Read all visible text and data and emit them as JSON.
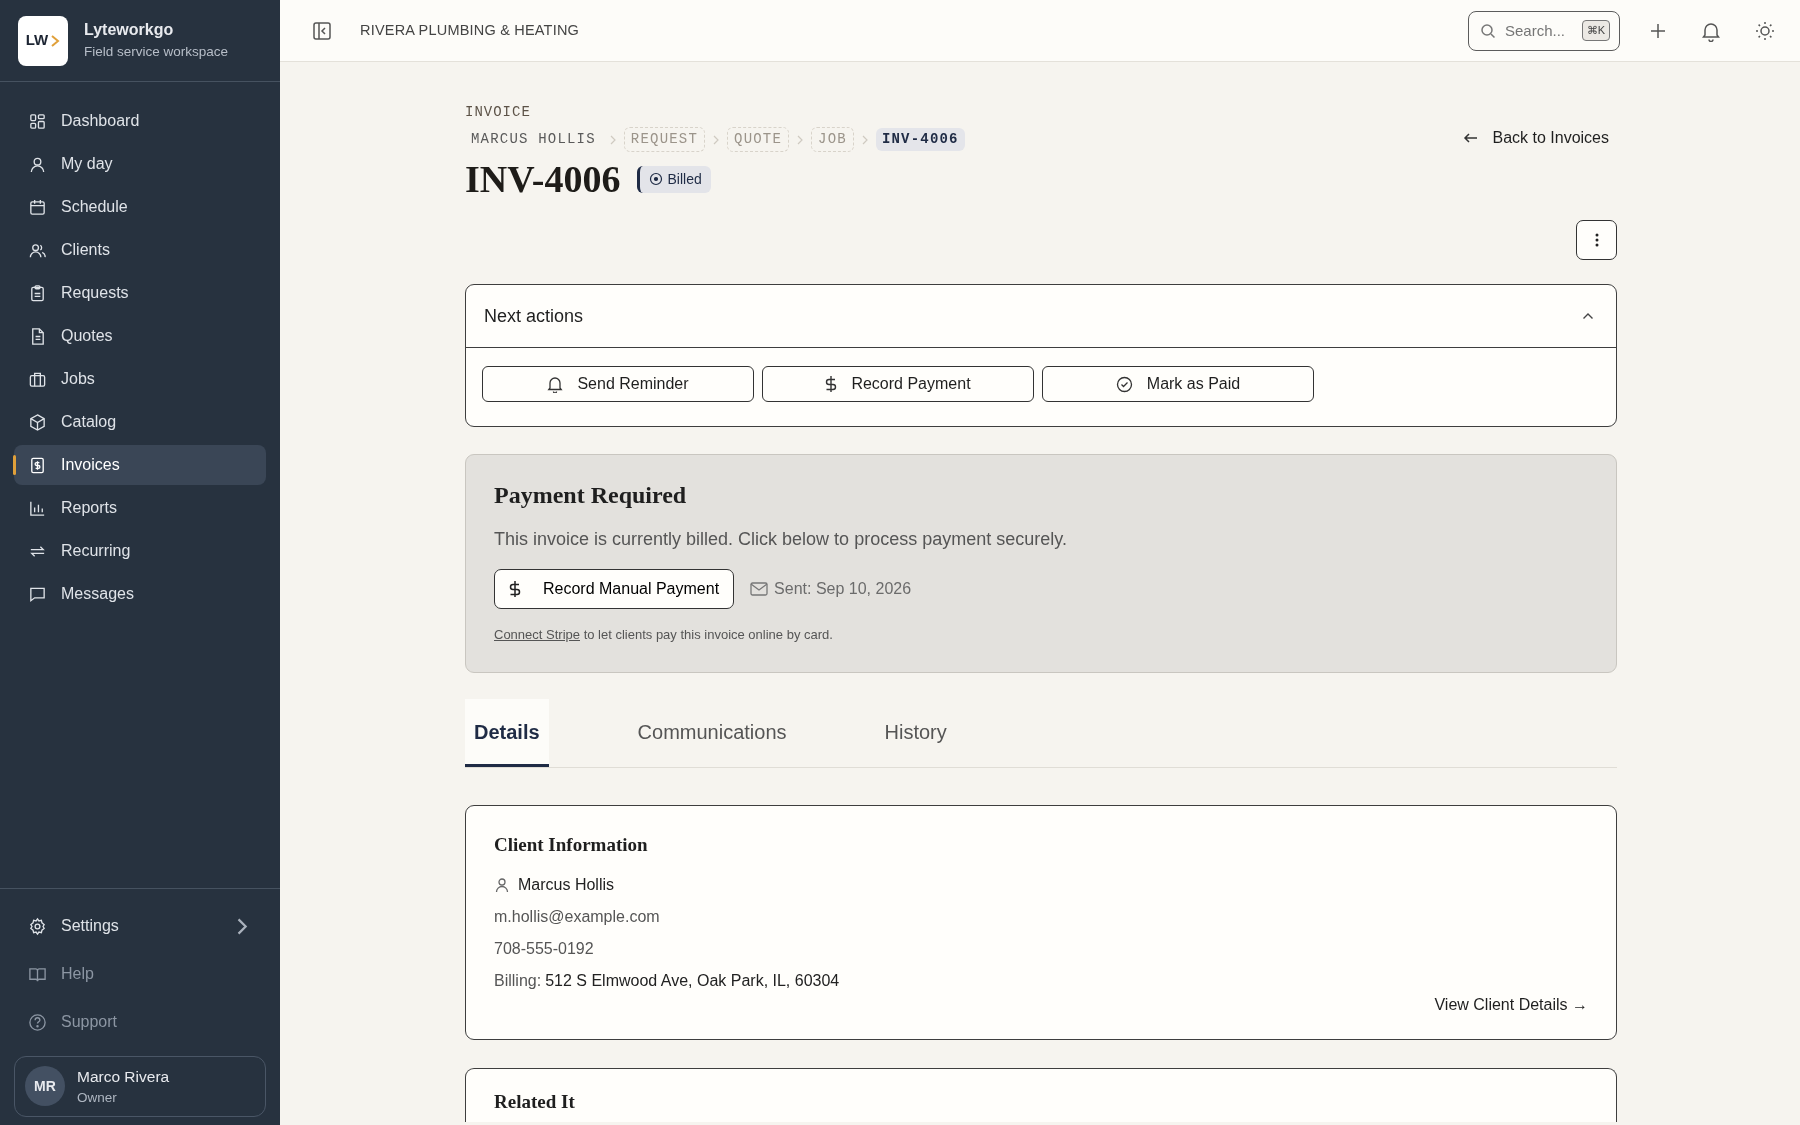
{
  "sidebar": {
    "brand": {
      "logo_text": "LW",
      "name": "Lyteworkgo",
      "subtitle": "Field service workspace"
    },
    "items": [
      {
        "label": "Dashboard",
        "selected": false
      },
      {
        "label": "My day",
        "selected": false
      },
      {
        "label": "Schedule",
        "selected": false
      },
      {
        "label": "Clients",
        "selected": false
      },
      {
        "label": "Requests",
        "selected": false
      },
      {
        "label": "Quotes",
        "selected": false
      },
      {
        "label": "Jobs",
        "selected": false
      },
      {
        "label": "Catalog",
        "selected": false
      },
      {
        "label": "Invoices",
        "selected": true
      },
      {
        "label": "Reports",
        "selected": false
      },
      {
        "label": "Recurring",
        "selected": false
      },
      {
        "label": "Messages",
        "selected": false
      }
    ],
    "footer_items": [
      {
        "label": "Settings",
        "disabled": false,
        "has_submenu": true
      },
      {
        "label": "Help",
        "disabled": true,
        "has_submenu": false
      },
      {
        "label": "Support",
        "disabled": true,
        "has_submenu": false
      }
    ],
    "user": {
      "initials": "MR",
      "name": "Marco Rivera",
      "role": "Owner"
    }
  },
  "topbar": {
    "company": "RIVERA PLUMBING & HEATING",
    "search": {
      "placeholder": "Search...",
      "shortcut": "⌘K"
    }
  },
  "header": {
    "eyebrow": "INVOICE",
    "breadcrumbs": [
      {
        "label": "MARCUS HOLLIS",
        "kind": "plain"
      },
      {
        "label": "REQUEST",
        "kind": "dashed"
      },
      {
        "label": "QUOTE",
        "kind": "dashed"
      },
      {
        "label": "JOB",
        "kind": "dashed"
      },
      {
        "label": "INV-4006",
        "kind": "current"
      }
    ],
    "title": "INV-4006",
    "status": "Billed",
    "back_link": "Back to Invoices"
  },
  "next_actions": {
    "title": "Next actions",
    "expanded": true,
    "buttons": [
      "Send Reminder",
      "Record Payment",
      "Mark as Paid"
    ]
  },
  "payment": {
    "title": "Payment Required",
    "message": "This invoice is currently billed. Click below to process payment securely.",
    "button": "Record Manual Payment",
    "sent": "Sent: Sep 10, 2026",
    "stripe_link": "Connect Stripe",
    "stripe_note": "to let clients pay this invoice online by card."
  },
  "tabs": [
    {
      "label": "Details",
      "selected": true
    },
    {
      "label": "Communications",
      "selected": false
    },
    {
      "label": "History",
      "selected": false
    }
  ],
  "client": {
    "title": "Client Information",
    "name": "Marcus Hollis",
    "email": "m.hollis@example.com",
    "phone": "708-555-0192",
    "billing_label": "Billing:",
    "billing_address": "512 S Elmwood Ave, Oak Park, IL, 60304",
    "link": "View Client Details →"
  },
  "related": {
    "title": "Related It"
  }
}
